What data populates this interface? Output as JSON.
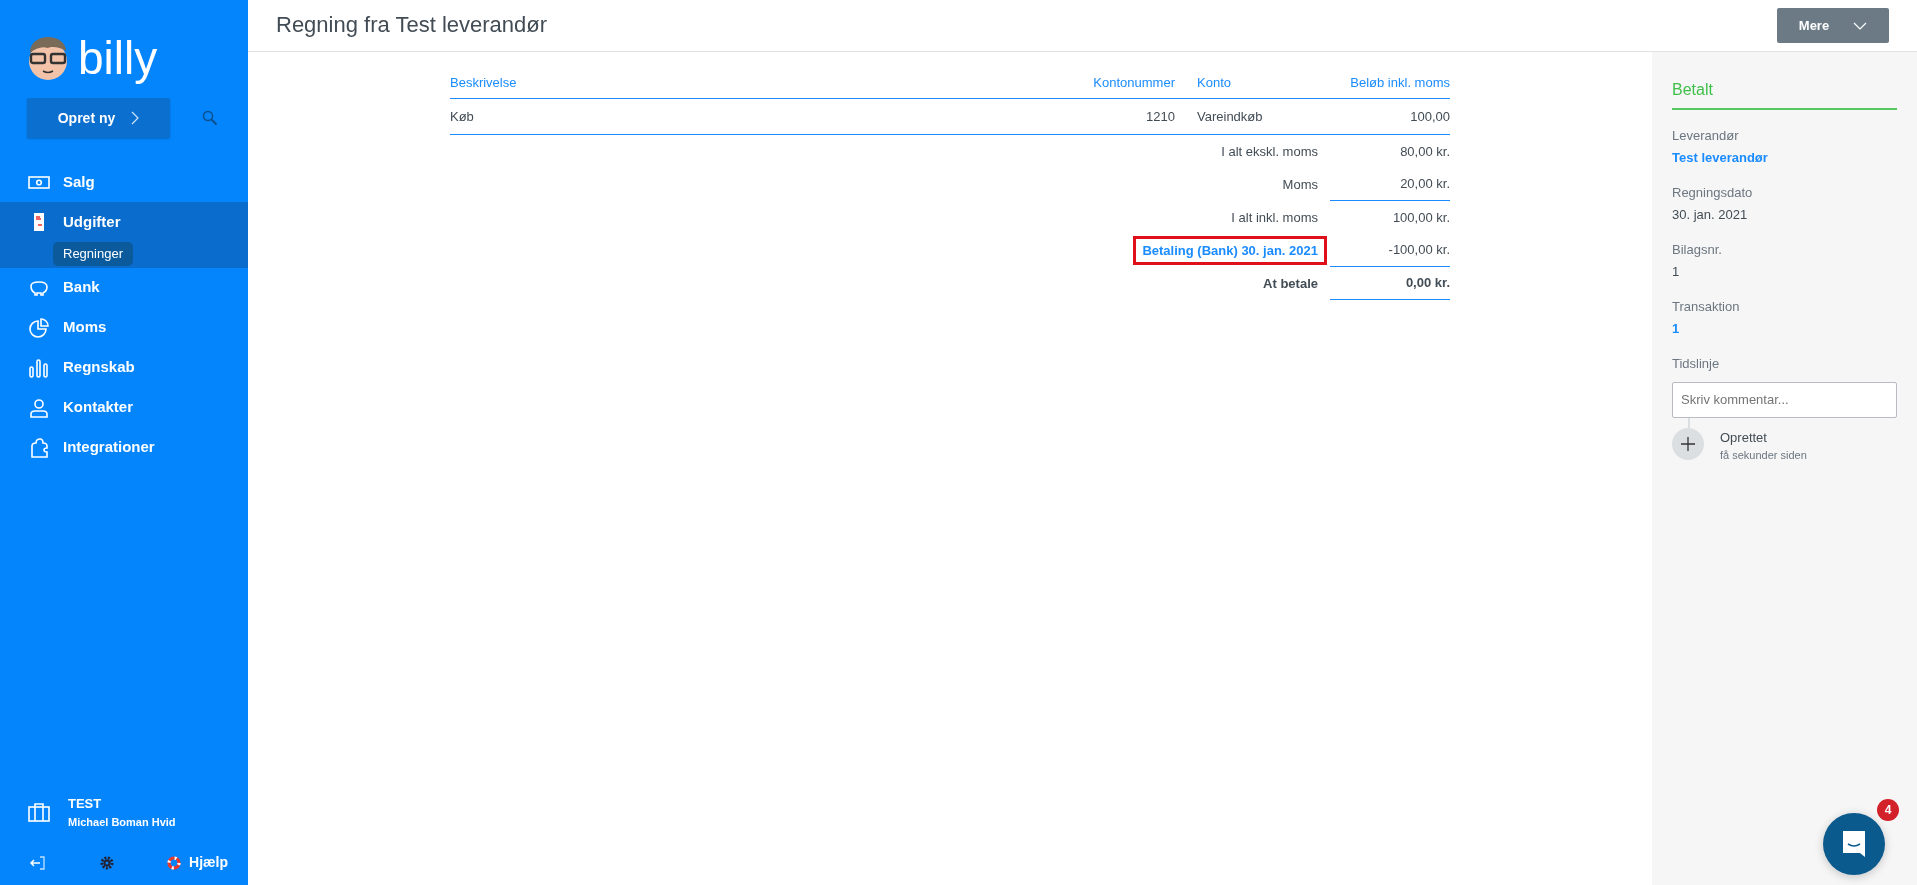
{
  "logo": {
    "text": "billy"
  },
  "create_button": {
    "label": "Opret ny"
  },
  "nav": [
    {
      "label": "Salg",
      "selected": false
    },
    {
      "label": "Udgifter",
      "selected": true,
      "children": [
        {
          "label": "Regninger",
          "selected": true
        }
      ]
    },
    {
      "label": "Bank",
      "selected": false
    },
    {
      "label": "Moms",
      "selected": false
    },
    {
      "label": "Regnskab",
      "selected": false
    },
    {
      "label": "Kontakter",
      "selected": false
    },
    {
      "label": "Integrationer",
      "selected": false
    }
  ],
  "account": {
    "company": "TEST",
    "user": "Michael Boman Hvid"
  },
  "help": {
    "label": "Hjælp"
  },
  "header": {
    "title": "Regning fra Test leverandør",
    "more_button": "Mere"
  },
  "table": {
    "columns": [
      "Beskrivelse",
      "Kontonummer",
      "Konto",
      "Beløb inkl. moms"
    ],
    "rows": [
      {
        "cells": [
          "Køb",
          "1210",
          "Vareindkøb",
          "100,00"
        ]
      }
    ],
    "totals": [
      {
        "label": "I alt ekskl. moms",
        "value": "80,00 kr.",
        "kind": "plain",
        "underline": false
      },
      {
        "label": "Moms",
        "value": "20,00 kr.",
        "kind": "plain",
        "underline": true
      },
      {
        "label": "I alt inkl. moms",
        "value": "100,00 kr.",
        "kind": "plain",
        "underline": false
      },
      {
        "label": "Betaling (Bank) 30. jan. 2021",
        "value": "-100,00 kr.",
        "kind": "link",
        "underline": true,
        "highlighted": true
      },
      {
        "label": "At betale",
        "value": "0,00 kr.",
        "kind": "bold",
        "underline": true
      }
    ]
  },
  "details": {
    "status": "Betalt",
    "fields": [
      {
        "label": "Leverandør",
        "value": "Test leverandør",
        "kind": "link"
      },
      {
        "label": "Regningsdato",
        "value": "30. jan. 2021",
        "kind": "text"
      },
      {
        "label": "Bilagsnr.",
        "value": "1",
        "kind": "text"
      },
      {
        "label": "Transaktion",
        "value": "1",
        "kind": "link"
      }
    ],
    "timeline": {
      "label": "Tidslinje",
      "placeholder": "Skriv kommentar...",
      "events": [
        {
          "title": "Oprettet",
          "time": "få sekunder siden"
        }
      ]
    }
  },
  "chat": {
    "badge": "4"
  }
}
